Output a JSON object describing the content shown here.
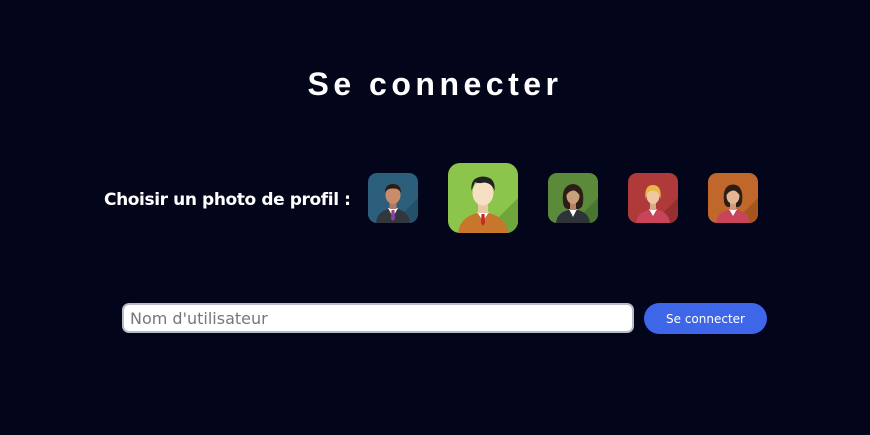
{
  "page": {
    "title": "Se connecter"
  },
  "avatar_picker": {
    "label": "Choisir un photo de profil :",
    "selected_index": 1,
    "avatars": [
      {
        "icon": "man-suit-purple-tie-avatar-icon",
        "bg": "#2b5f7a"
      },
      {
        "icon": "man-orange-sweater-avatar-icon",
        "bg": "#8bc34a"
      },
      {
        "icon": "woman-dark-suit-avatar-icon",
        "bg": "#5d8a3a"
      },
      {
        "icon": "woman-blonde-red-jacket-avatar-icon",
        "bg": "#b23a3a"
      },
      {
        "icon": "woman-red-jacket-avatar-icon",
        "bg": "#c0672b"
      }
    ]
  },
  "login_form": {
    "username_placeholder": "Nom d'utilisateur",
    "username_value": "",
    "submit_label": "Se connecter"
  },
  "colors": {
    "background": "#03051a",
    "accent": "#3e66e8"
  }
}
